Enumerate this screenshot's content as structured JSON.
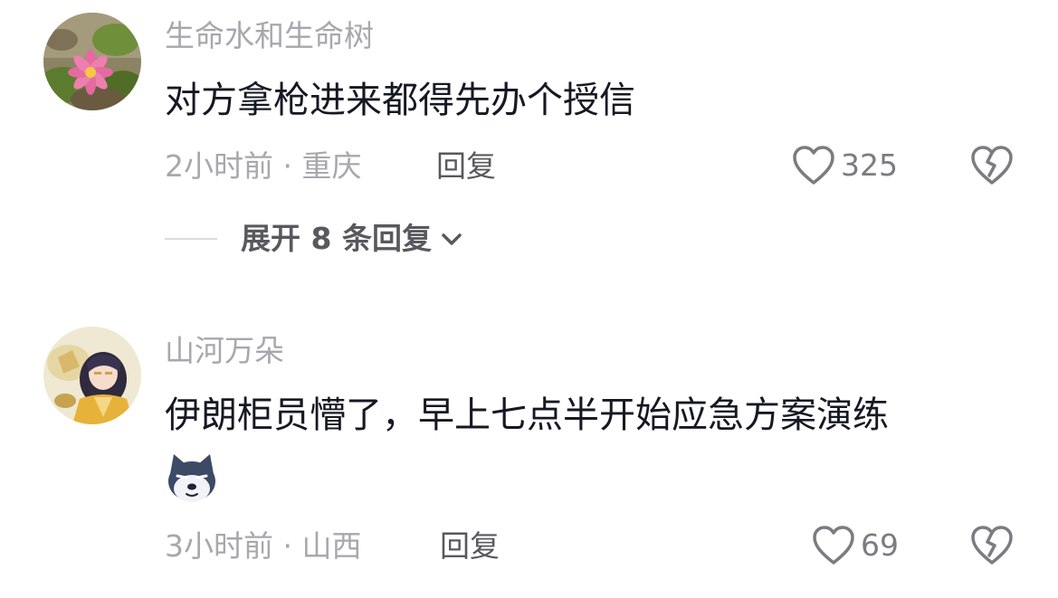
{
  "comments": [
    {
      "username": "生命水和生命树",
      "text": "对方拿枪进来都得先办个授信",
      "time_location": "2小时前 · 重庆",
      "reply_label": "回复",
      "like_count": "325",
      "expand_label": "展开 8 条回复"
    },
    {
      "username": "山河万朵",
      "text": "伊朗柜员懵了，早上七点半开始应急方案演练",
      "time_location": "3小时前 · 山西",
      "reply_label": "回复",
      "like_count": "69"
    }
  ],
  "colors": {
    "username": "#a7a8ad",
    "text": "#161823",
    "meta": "#a7a8ad",
    "action": "#58595e",
    "icon": "#7b7c81"
  },
  "icons": [
    "heart-outline-icon",
    "broken-heart-icon",
    "chevron-down-icon",
    "husky-emoji-icon"
  ]
}
